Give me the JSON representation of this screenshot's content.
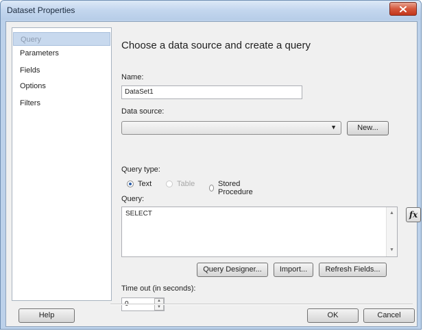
{
  "window": {
    "title": "Dataset Properties"
  },
  "nav": {
    "items": [
      {
        "label": "Query"
      },
      {
        "label": "Parameters"
      },
      {
        "label": "Fields"
      },
      {
        "label": "Options"
      },
      {
        "label": "Filters"
      }
    ],
    "selected": "Query"
  },
  "main": {
    "heading": "Choose a data source and create a query",
    "name": {
      "label": "Name:",
      "value": "DataSet1"
    },
    "data_source": {
      "label": "Data source:",
      "value": "",
      "new_button": "New..."
    },
    "query_type": {
      "label": "Query type:",
      "options": [
        {
          "label": "Text",
          "checked": true,
          "enabled": true
        },
        {
          "label": "Table",
          "checked": false,
          "enabled": false
        },
        {
          "label": "Stored Procedure",
          "checked": false,
          "enabled": true
        }
      ]
    },
    "query": {
      "label": "Query:",
      "value": "SELECT",
      "fx_label": "fx"
    },
    "buttons": {
      "query_designer": "Query Designer...",
      "import": "Import...",
      "refresh_fields": "Refresh Fields..."
    },
    "timeout": {
      "label": "Time out (in seconds):",
      "value": "0"
    }
  },
  "footer": {
    "help": "Help",
    "ok": "OK",
    "cancel": "Cancel"
  },
  "colors": {
    "close_button": "#c2361b",
    "selected_nav": "#c8d9ee",
    "title_bar": "#c3d6ee"
  }
}
